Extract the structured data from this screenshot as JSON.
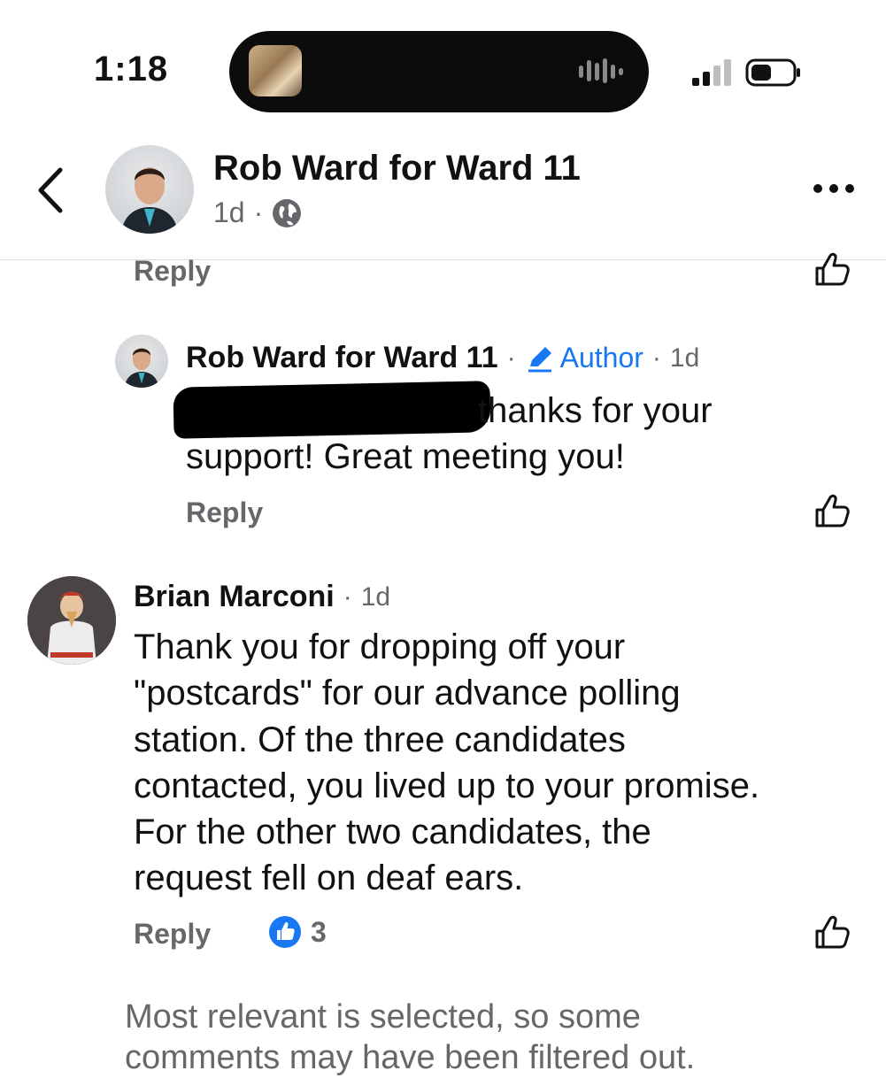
{
  "status_bar": {
    "time": "1:18"
  },
  "header": {
    "page_name": "Rob Ward for Ward 11",
    "age": "1d",
    "separator": "·"
  },
  "top_reply": {
    "reply_label": "Reply"
  },
  "author_reply": {
    "name": "Rob Ward for Ward 11",
    "badge": "Author",
    "age": "1d",
    "text_line1": "thanks for your",
    "text_line2": "support! Great meeting you!",
    "reply_label": "Reply"
  },
  "comment": {
    "name": "Brian Marconi",
    "age": "1d",
    "lines": [
      "Thank you for dropping off your",
      "\"postcards\" for our advance polling",
      "station.  Of the three candidates",
      "contacted, you lived up to your promise.",
      "For the other two candidates, the",
      "request fell on deaf ears."
    ],
    "reply_label": "Reply",
    "like_count": "3"
  },
  "footer": {
    "line1": "Most relevant is selected, so some",
    "line2": "comments may have been filtered out."
  },
  "colors": {
    "accent": "#1877f2",
    "secondary_text": "#65676b",
    "divider": "#dadde1"
  },
  "icons": [
    "back-chevron-icon",
    "globe-icon",
    "more-icon",
    "like-icon",
    "pencil-icon",
    "signal-icon",
    "battery-icon",
    "audio-wave-icon"
  ]
}
